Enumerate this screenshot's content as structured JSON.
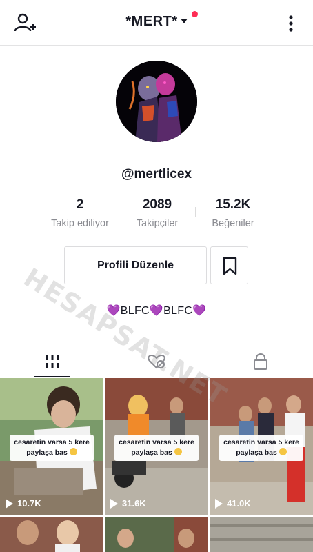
{
  "header": {
    "title": "*MERT*",
    "icons": {
      "add_user": "person-add-icon",
      "dropdown": "caret-down-icon",
      "more": "more-vertical-icon"
    },
    "notification_color": "#fe2c55"
  },
  "profile": {
    "username": "@mertlicex",
    "stats": [
      {
        "value": "2",
        "label": "Takip ediliyor"
      },
      {
        "value": "2089",
        "label": "Takipçiler"
      },
      {
        "value": "15.2K",
        "label": "Beğeniler"
      }
    ],
    "edit_label": "Profili Düzenle",
    "bio": "💜BLFC💜BLFC💜"
  },
  "tabs": [
    {
      "icon": "grid-icon",
      "active": true
    },
    {
      "icon": "liked-videos-icon",
      "active": false
    },
    {
      "icon": "lock-icon",
      "active": false
    }
  ],
  "videos": [
    {
      "caption_line1": "cesaretin varsa 5 kere",
      "caption_line2": "paylaşa bas",
      "views": "10.7K"
    },
    {
      "caption_line1": "cesaretin varsa 5 kere",
      "caption_line2": "paylaşa bas",
      "views": "31.6K"
    },
    {
      "caption_line1": "cesaretin varsa 5 kere",
      "caption_line2": "paylaşa bas",
      "views": "41.0K"
    }
  ],
  "watermark": "HESAPSAT.NET"
}
